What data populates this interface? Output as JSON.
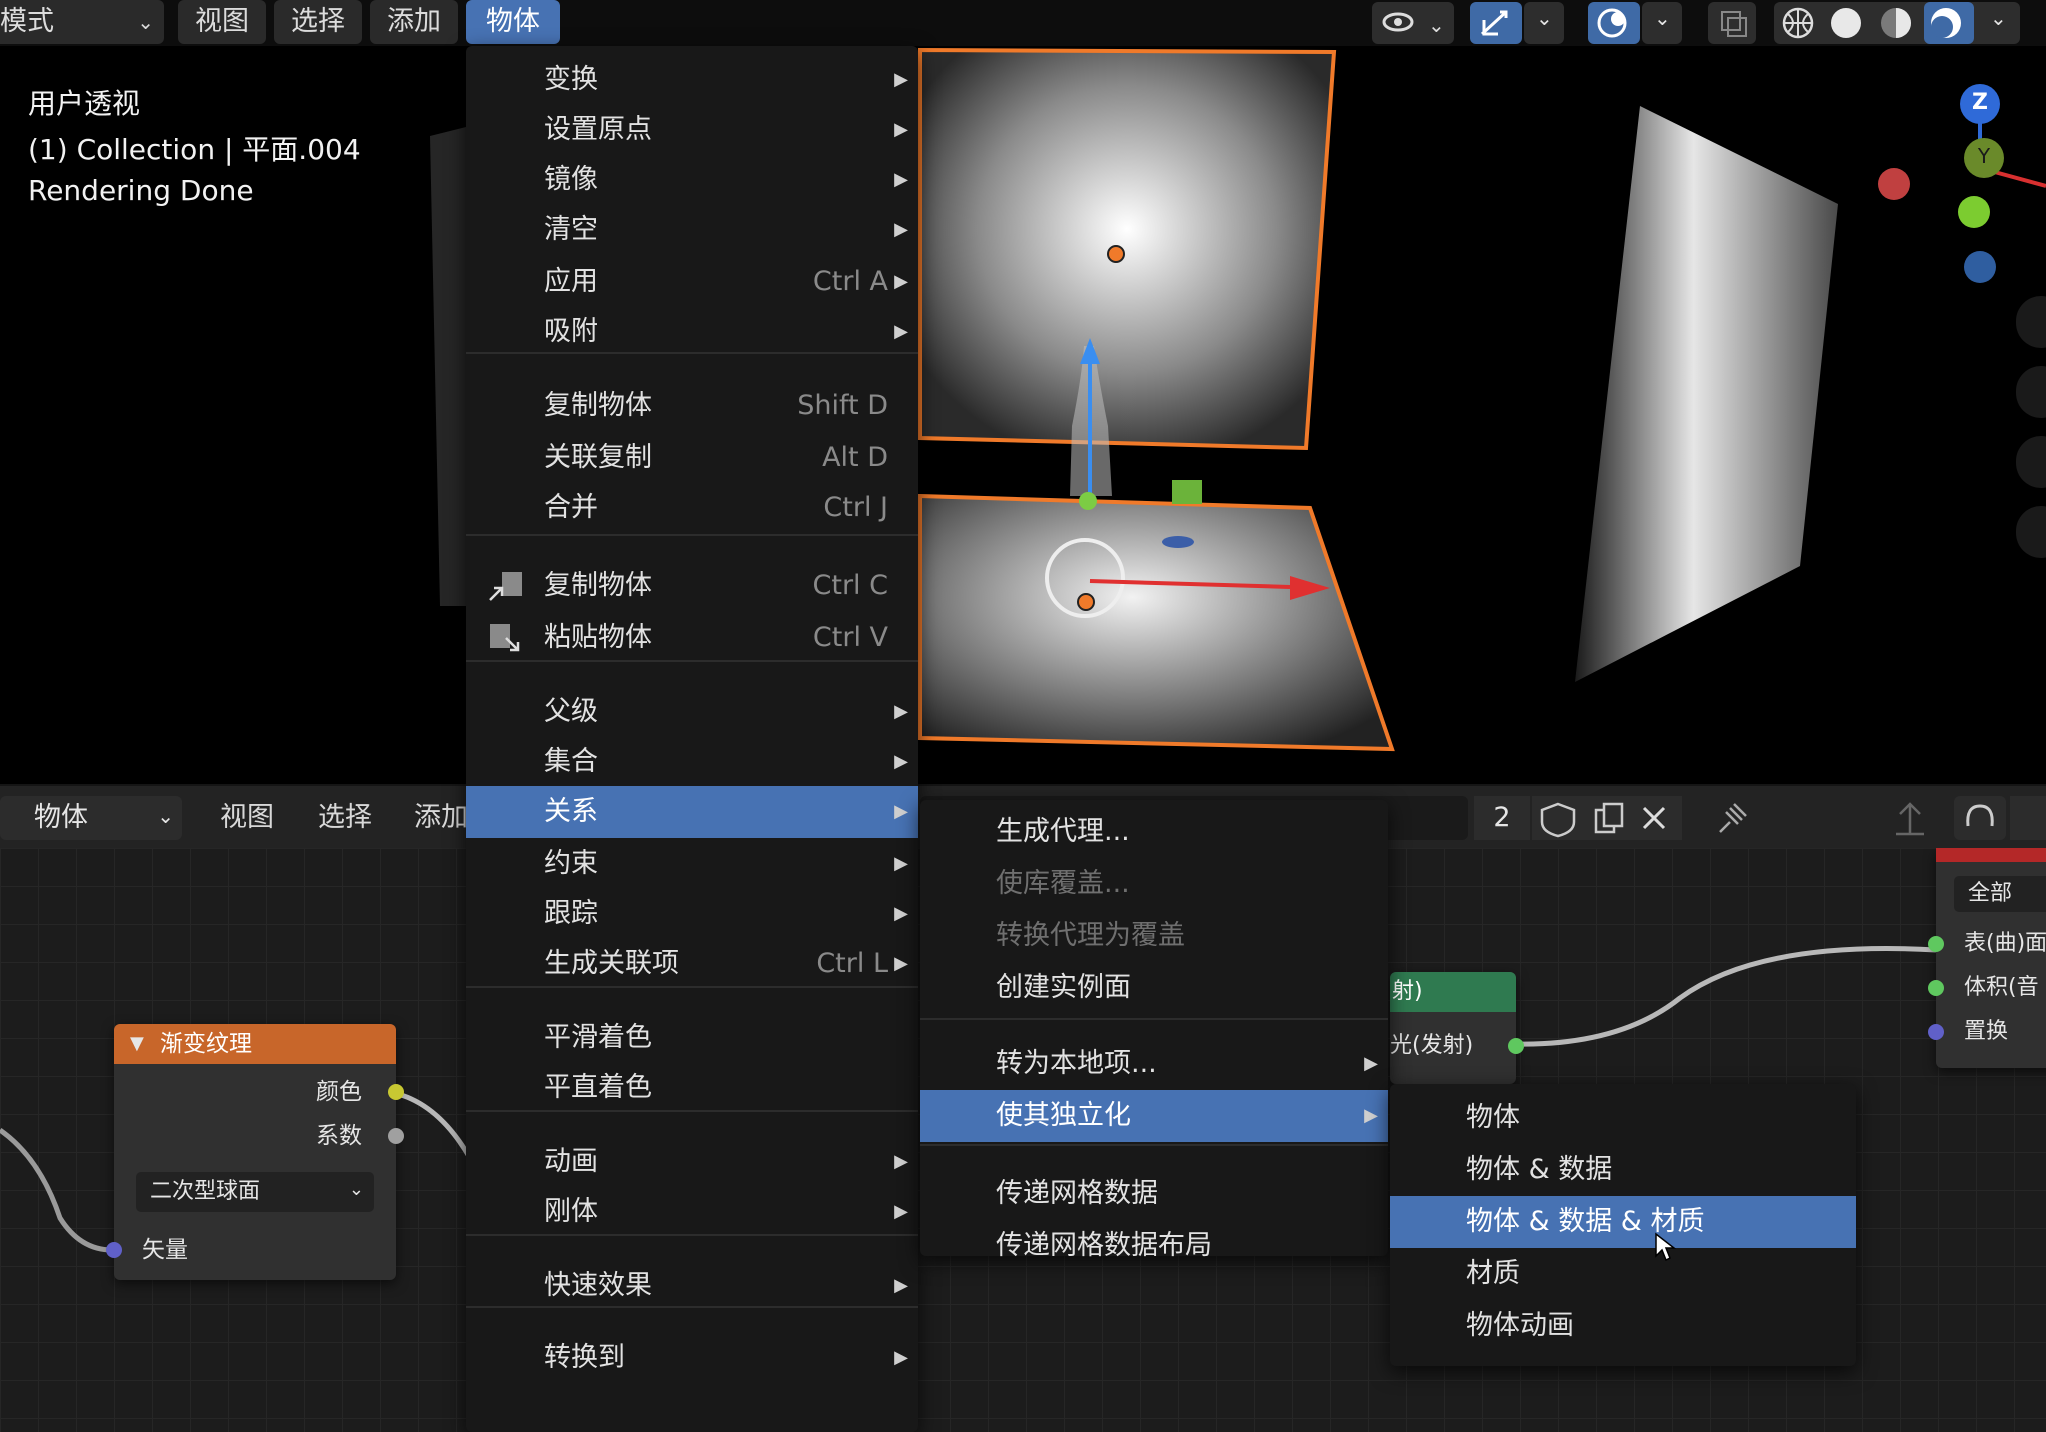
{
  "header": {
    "mode_label": "模式",
    "menu_view": "视图",
    "menu_select": "选择",
    "menu_add": "添加",
    "menu_object": "物体"
  },
  "viewport": {
    "view_name": "用户透视",
    "collection_line": "(1) Collection | 平面.004",
    "status": "Rendering Done",
    "gizmo_z": "Z",
    "gizmo_y": "Y"
  },
  "object_menu": {
    "items": [
      {
        "label": "变换",
        "shortcut": ""
      },
      {
        "label": "设置原点",
        "shortcut": ""
      },
      {
        "label": "镜像",
        "shortcut": ""
      },
      {
        "label": "清空",
        "shortcut": ""
      },
      {
        "label": "应用",
        "shortcut": "Ctrl A"
      },
      {
        "label": "吸附",
        "shortcut": ""
      },
      {
        "label": "复制物体",
        "shortcut": "Shift D"
      },
      {
        "label": "关联复制",
        "shortcut": "Alt D"
      },
      {
        "label": "合并",
        "shortcut": "Ctrl J"
      },
      {
        "label": "复制物体",
        "shortcut": "Ctrl C"
      },
      {
        "label": "粘贴物体",
        "shortcut": "Ctrl V"
      },
      {
        "label": "父级",
        "shortcut": ""
      },
      {
        "label": "集合",
        "shortcut": ""
      },
      {
        "label": "关系",
        "shortcut": ""
      },
      {
        "label": "约束",
        "shortcut": ""
      },
      {
        "label": "跟踪",
        "shortcut": ""
      },
      {
        "label": "生成关联项",
        "shortcut": "Ctrl L"
      },
      {
        "label": "平滑着色",
        "shortcut": ""
      },
      {
        "label": "平直着色",
        "shortcut": ""
      },
      {
        "label": "动画",
        "shortcut": ""
      },
      {
        "label": "刚体",
        "shortcut": ""
      },
      {
        "label": "快速效果",
        "shortcut": ""
      },
      {
        "label": "转换到",
        "shortcut": ""
      }
    ]
  },
  "relations_menu": {
    "items": [
      {
        "label": "生成代理..."
      },
      {
        "label": "使库覆盖..."
      },
      {
        "label": "转换代理为覆盖"
      },
      {
        "label": "创建实例面"
      },
      {
        "label": "转为本地项..."
      },
      {
        "label": "使其独立化"
      },
      {
        "label": "传递网格数据"
      },
      {
        "label": "传递网格数据布局"
      }
    ]
  },
  "single_user_menu": {
    "items": [
      {
        "label": "物体"
      },
      {
        "label": "物体 & 数据"
      },
      {
        "label": "物体 & 数据 & 材质"
      },
      {
        "label": "材质"
      },
      {
        "label": "物体动画"
      }
    ]
  },
  "node_header": {
    "object_dropdown": "物体",
    "menu_view": "视图",
    "menu_select": "选择",
    "menu_add": "添加",
    "material_users": "2"
  },
  "gradient_node": {
    "title": "渐变纹理",
    "out_color": "颜色",
    "out_factor": "系数",
    "type_value": "二次型球面",
    "in_vector": "矢量"
  },
  "emission_node": {
    "title": "射)",
    "output": "光(发射)"
  },
  "output_node": {
    "target": "全部",
    "surface": "表(曲)面",
    "volume": "体积(音",
    "displacement": "置换"
  },
  "colors": {
    "accent": "#4772b3",
    "selection_orange": "#f0782a",
    "texture_header": "#c8662a",
    "emission_header": "#2f7a50"
  }
}
